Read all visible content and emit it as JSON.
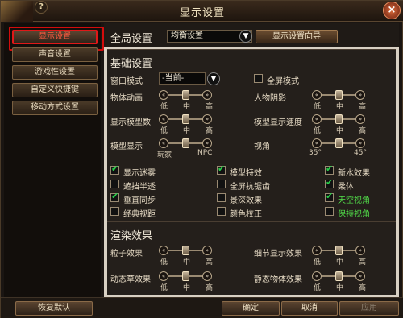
{
  "window": {
    "title": "显示设置",
    "help": "?",
    "close": "×"
  },
  "sidebar": {
    "items": [
      {
        "label": "显示设置",
        "active": true
      },
      {
        "label": "声音设置"
      },
      {
        "label": "游戏性设置"
      },
      {
        "label": "自定义快捷键"
      },
      {
        "label": "移动方式设置"
      }
    ]
  },
  "global": {
    "label": "全局设置",
    "preset": "均衡设置",
    "wizard_label": "显示设置向导",
    "dropdown_icon": "chevron-down-icon"
  },
  "basic": {
    "title": "基础设置",
    "window_mode_label": "窗口模式",
    "window_mode_value": "-当前-",
    "fullscreen_label": "全屏模式",
    "object_anim": {
      "label": "物体动画",
      "low": "低",
      "mid": "中",
      "high": "高",
      "level": 0.5
    },
    "char_shadow": {
      "label": "人物阴影",
      "low": "低",
      "mid": "中",
      "high": "高",
      "level": 0.5
    },
    "model_count": {
      "label": "显示模型数",
      "low": "低",
      "mid": "中",
      "high": "高",
      "level": 0.5
    },
    "model_speed": {
      "label": "模型显示速度",
      "low": "低",
      "mid": "中",
      "high": "高",
      "level": 0.5
    },
    "model_display": {
      "label": "模型显示",
      "left": "玩家",
      "right": "NPC",
      "level": 0.5
    },
    "view_angle": {
      "label": "视角",
      "left": "35°",
      "right": "45°",
      "level": 0.5
    },
    "checkboxes": [
      {
        "label": "显示迷雾",
        "checked": true,
        "green": false
      },
      {
        "label": "模型特效",
        "checked": true,
        "green": false
      },
      {
        "label": "新水效果",
        "checked": true,
        "green": false
      },
      {
        "label": "遮挡半透",
        "checked": false,
        "green": false
      },
      {
        "label": "全屏抗锯齿",
        "checked": false,
        "green": false
      },
      {
        "label": "柔体",
        "checked": true,
        "green": false
      },
      {
        "label": "垂直同步",
        "checked": true,
        "green": false
      },
      {
        "label": "景深效果",
        "checked": false,
        "green": false
      },
      {
        "label": "天空视角",
        "checked": true,
        "green": true
      },
      {
        "label": "经典视距",
        "checked": false,
        "green": false
      },
      {
        "label": "颜色校正",
        "checked": false,
        "green": false
      },
      {
        "label": "保持视角",
        "checked": false,
        "green": true
      }
    ]
  },
  "render": {
    "title": "渲染效果",
    "particle": {
      "label": "粒子效果",
      "low": "低",
      "mid": "中",
      "high": "高",
      "level": 0.5
    },
    "detail": {
      "label": "细节显示效果",
      "low": "低",
      "mid": "中",
      "high": "高",
      "level": 0.5
    },
    "grass": {
      "label": "动态草效果",
      "low": "低",
      "mid": "中",
      "high": "高",
      "level": 0.5
    },
    "static_obj": {
      "label": "静态物体效果",
      "low": "低",
      "mid": "中",
      "high": "高",
      "level": 0.5
    }
  },
  "footer": {
    "restore": "恢复默认",
    "ok": "确定",
    "cancel": "取消",
    "apply": "应用"
  }
}
